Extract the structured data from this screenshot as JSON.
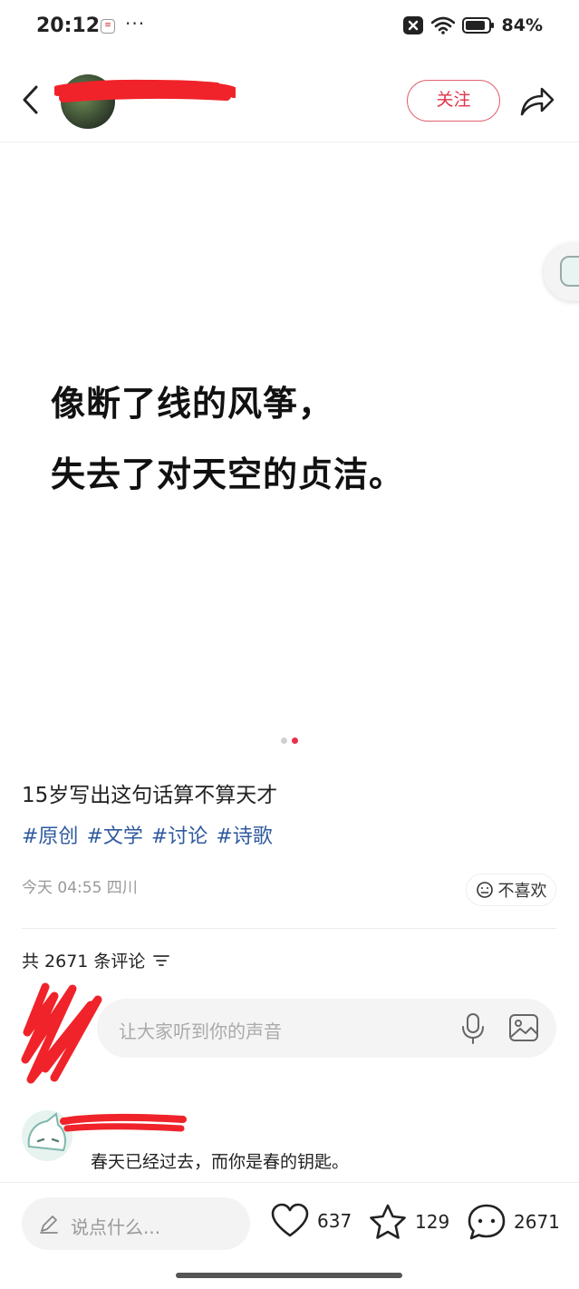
{
  "status_bar": {
    "time": "20:12",
    "notification_icon": "app-notification-icon",
    "more": "···",
    "battery": "84%"
  },
  "header": {
    "follow_label": "关注"
  },
  "post": {
    "image_text": [
      "像断了线的风筝，",
      "失去了对天空的贞洁。"
    ],
    "title": "15岁写出这句话算不算天才",
    "tags": [
      "#原创",
      "#文学",
      "#讨论",
      "#诗歌"
    ],
    "meta": "今天 04:55 四川",
    "dislike_label": "不喜欢"
  },
  "comments": {
    "count_label": "共 2671 条评论",
    "input_placeholder": "让大家听到你的声音",
    "items": [
      {
        "text": "春天已经过去，而你是春的钥匙。"
      }
    ]
  },
  "bottom_bar": {
    "say_placeholder": "说点什么...",
    "likes": "637",
    "favorites": "129",
    "comments": "2671"
  },
  "colors": {
    "accent": "#e8304a",
    "tag": "#2f5aa0"
  }
}
